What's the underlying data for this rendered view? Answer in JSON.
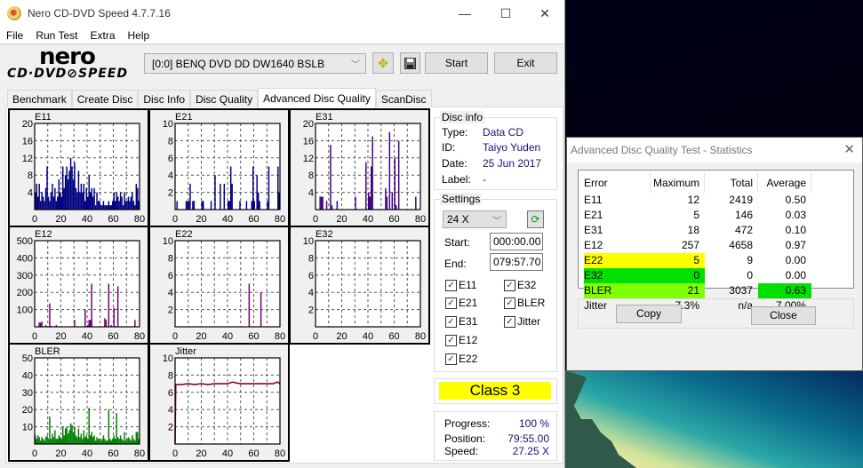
{
  "window": {
    "title": "Nero CD-DVD Speed 4.7.7.16",
    "minimize_glyph": "—",
    "maximize_glyph": "☐",
    "close_glyph": "✕"
  },
  "menu": [
    "File",
    "Run Test",
    "Extra",
    "Help"
  ],
  "logo": {
    "top": "nero",
    "bottom": "CD·DVD⊘SPEED"
  },
  "toolbar": {
    "drive": "[0:0]   BENQ DVD DD DW1640 BSLB",
    "start_label": "Start",
    "exit_label": "Exit",
    "prefs_icon": "✥",
    "save_icon": "💾"
  },
  "tabs": [
    {
      "label": "Benchmark",
      "active": false
    },
    {
      "label": "Create Disc",
      "active": false
    },
    {
      "label": "Disc Info",
      "active": false
    },
    {
      "label": "Disc Quality",
      "active": false
    },
    {
      "label": "Advanced Disc Quality",
      "active": true
    },
    {
      "label": "ScanDisc",
      "active": false
    }
  ],
  "disc_info": {
    "title": "Disc info",
    "rows": [
      {
        "label": "Type:",
        "value": "Data CD"
      },
      {
        "label": "ID:",
        "value": "Taiyo Yuden"
      },
      {
        "label": "Date:",
        "value": "25 Jun 2017"
      },
      {
        "label": "Label:",
        "value": "-"
      }
    ]
  },
  "settings": {
    "title": "Settings",
    "speed": "24 X",
    "start_label": "Start:",
    "start_value": "000:00.00",
    "end_label": "End:",
    "end_value": "079:57.70",
    "checkboxes": [
      {
        "label": "E11",
        "checked": true
      },
      {
        "label": "E32",
        "checked": true
      },
      {
        "label": "E21",
        "checked": true
      },
      {
        "label": "BLER",
        "checked": true
      },
      {
        "label": "E31",
        "checked": true
      },
      {
        "label": "Jitter",
        "checked": true
      },
      {
        "label": "E12",
        "checked": true
      },
      {
        "label": "E22",
        "checked": true
      }
    ]
  },
  "class_badge": {
    "text": "Class 3",
    "color": "#ffff00"
  },
  "progress": {
    "rows": [
      {
        "label": "Progress:",
        "value": "100 %"
      },
      {
        "label": "Position:",
        "value": "79:55.00"
      },
      {
        "label": "Speed:",
        "value": "27.25 X"
      }
    ]
  },
  "stats_dialog": {
    "title": "Advanced Disc Quality Test - Statistics",
    "headers": [
      "Error",
      "Maximum",
      "Total",
      "Average"
    ],
    "rows": [
      {
        "name": "E11",
        "max": "12",
        "total": "2419",
        "avg": "0.50",
        "hl_name": "",
        "hl_avg": ""
      },
      {
        "name": "E21",
        "max": "5",
        "total": "146",
        "avg": "0.03",
        "hl_name": "",
        "hl_avg": ""
      },
      {
        "name": "E31",
        "max": "18",
        "total": "472",
        "avg": "0.10",
        "hl_name": "",
        "hl_avg": ""
      },
      {
        "name": "E12",
        "max": "257",
        "total": "4658",
        "avg": "0.97",
        "hl_name": "",
        "hl_avg": ""
      },
      {
        "name": "E22",
        "max": "5",
        "total": "9",
        "avg": "0.00",
        "hl_name": "#ffff00",
        "hl_avg": ""
      },
      {
        "name": "E32",
        "max": "0",
        "total": "0",
        "avg": "0.00",
        "hl_name": "#00e000",
        "hl_avg": ""
      },
      {
        "name": "BLER",
        "max": "21",
        "total": "3037",
        "avg": "0.63",
        "hl_name": "#80ff00",
        "hl_avg": "#00e000"
      },
      {
        "name": "Jitter",
        "max": "7.3%",
        "total": "n/a",
        "avg": "7.00%",
        "hl_name": "",
        "hl_avg": ""
      }
    ],
    "copy_label": "Copy",
    "close_label": "Close",
    "close_glyph": "✕"
  },
  "chart_data": [
    {
      "type": "bar",
      "title": "E11",
      "color": "#000080",
      "xlim": [
        0,
        80
      ],
      "ylim": [
        0,
        20
      ],
      "xticks": [
        0,
        20,
        40,
        60,
        80
      ],
      "yticks": [
        4,
        8,
        12,
        16,
        20
      ],
      "yticklabels": [
        "4",
        "8",
        "12",
        "16",
        "20"
      ],
      "grid": true,
      "x": [
        0,
        1,
        2,
        3,
        4,
        5,
        6,
        7,
        8,
        9,
        10,
        11,
        12,
        13,
        14,
        15,
        16,
        17,
        18,
        19,
        20,
        21,
        22,
        23,
        24,
        25,
        26,
        27,
        28,
        29,
        30,
        31,
        32,
        33,
        34,
        35,
        36,
        37,
        38,
        39,
        40,
        41,
        42,
        43,
        44,
        45,
        46,
        47,
        48,
        49,
        50,
        51,
        52,
        53,
        54,
        55,
        56,
        57,
        58,
        59,
        60,
        61,
        62,
        63,
        64,
        65,
        66,
        67,
        68,
        69,
        70,
        71,
        72,
        73,
        74,
        75,
        76,
        77,
        78,
        79
      ],
      "values": [
        4,
        6,
        3,
        6,
        2,
        4,
        3,
        2,
        5,
        10,
        3,
        2,
        4,
        6,
        3,
        5,
        2,
        3,
        7,
        4,
        3,
        10,
        5,
        8,
        10,
        7,
        9,
        12,
        10,
        7,
        11,
        5,
        4,
        9,
        4,
        6,
        4,
        6,
        2,
        5,
        3,
        8,
        4,
        5,
        3,
        5,
        1,
        4,
        2,
        2,
        1,
        1,
        2,
        1,
        1,
        1,
        2,
        1,
        1,
        2,
        4,
        2,
        4,
        3,
        2,
        4,
        3,
        1,
        4,
        2,
        2,
        3,
        2,
        3,
        4,
        2,
        1,
        6,
        5,
        2
      ]
    },
    {
      "type": "bar",
      "title": "E21",
      "color": "#000080",
      "xlim": [
        0,
        80
      ],
      "ylim": [
        0,
        10
      ],
      "xticks": [
        0,
        20,
        40,
        60,
        80
      ],
      "yticks": [
        2,
        4,
        6,
        8,
        10
      ],
      "yticklabels": [
        "2",
        "4",
        "6",
        "8",
        "10"
      ],
      "grid": true,
      "x": [
        1,
        8,
        9,
        10,
        11,
        13,
        14,
        20,
        21,
        27,
        30,
        34,
        37,
        40,
        41,
        42,
        43,
        49,
        54,
        58,
        59,
        60,
        62,
        63,
        64,
        70,
        71,
        78,
        79
      ],
      "values": [
        1,
        1,
        1,
        1,
        3,
        1,
        1,
        1,
        1,
        1,
        4,
        3,
        3,
        1,
        1,
        5,
        3,
        1,
        1,
        1,
        5,
        1,
        4,
        2,
        1,
        1,
        5,
        5,
        2
      ]
    },
    {
      "type": "bar",
      "title": "E31",
      "color": "#400080",
      "xlim": [
        0,
        80
      ],
      "ylim": [
        0,
        20
      ],
      "xticks": [
        0,
        20,
        40,
        60,
        80
      ],
      "yticks": [
        4,
        8,
        12,
        16,
        20
      ],
      "yticklabels": [
        "4",
        "8",
        "12",
        "16",
        "20"
      ],
      "grid": true,
      "x": [
        3,
        4,
        5,
        8,
        11,
        12,
        16,
        30,
        38,
        40,
        41,
        42,
        43,
        53,
        54,
        56,
        58,
        60,
        61,
        63,
        76
      ],
      "values": [
        3,
        3,
        3,
        2,
        15,
        1,
        2,
        3,
        11,
        4,
        3,
        10,
        17,
        5,
        3,
        18,
        4,
        12,
        1,
        16,
        3
      ]
    },
    {
      "type": "bar",
      "title": "E12",
      "color": "#700070",
      "xlim": [
        0,
        80
      ],
      "ylim": [
        0,
        500
      ],
      "xticks": [
        0,
        20,
        40,
        60,
        80
      ],
      "yticks": [
        100,
        200,
        300,
        400,
        500
      ],
      "yticklabels": [
        "100",
        "200",
        "300",
        "400",
        "500"
      ],
      "grid": true,
      "x": [
        3,
        4,
        5,
        8,
        11,
        12,
        16,
        30,
        38,
        40,
        41,
        42,
        43,
        53,
        54,
        56,
        58,
        60,
        61,
        63,
        76
      ],
      "values": [
        25,
        25,
        30,
        10,
        135,
        5,
        10,
        40,
        100,
        10,
        40,
        40,
        250,
        50,
        40,
        250,
        10,
        110,
        5,
        235,
        40
      ]
    },
    {
      "type": "bar",
      "title": "E22",
      "color": "#700070",
      "xlim": [
        0,
        80
      ],
      "ylim": [
        0,
        10
      ],
      "xticks": [
        0,
        20,
        40,
        60,
        80
      ],
      "yticks": [
        2,
        4,
        6,
        8,
        10
      ],
      "yticklabels": [
        "2",
        "4",
        "6",
        "8",
        "10"
      ],
      "grid": true,
      "x": [
        56,
        65
      ],
      "values": [
        5,
        4
      ]
    },
    {
      "type": "bar",
      "title": "E32",
      "color": "#700070",
      "xlim": [
        0,
        80
      ],
      "ylim": [
        0,
        10
      ],
      "xticks": [
        0,
        20,
        40,
        60,
        80
      ],
      "yticks": [
        2,
        4,
        6,
        8,
        10
      ],
      "yticklabels": [
        "2",
        "4",
        "6",
        "8",
        "10"
      ],
      "grid": true,
      "x": [],
      "values": []
    },
    {
      "type": "bar",
      "title": "BLER",
      "color": "#008000",
      "xlim": [
        0,
        80
      ],
      "ylim": [
        0,
        50
      ],
      "xticks": [
        0,
        20,
        40,
        60,
        80
      ],
      "yticks": [
        10,
        20,
        30,
        40,
        50
      ],
      "yticklabels": [
        "10",
        "20",
        "30",
        "40",
        "50"
      ],
      "grid": true,
      "x": [
        0,
        1,
        2,
        3,
        4,
        5,
        6,
        7,
        8,
        9,
        10,
        11,
        12,
        13,
        14,
        15,
        16,
        17,
        18,
        19,
        20,
        21,
        22,
        23,
        24,
        25,
        26,
        27,
        28,
        29,
        30,
        31,
        32,
        33,
        34,
        35,
        36,
        37,
        38,
        39,
        40,
        41,
        42,
        43,
        44,
        45,
        46,
        47,
        48,
        49,
        50,
        51,
        52,
        53,
        54,
        55,
        56,
        57,
        58,
        59,
        60,
        61,
        62,
        63,
        64,
        65,
        66,
        67,
        68,
        69,
        70,
        71,
        72,
        73,
        74,
        75,
        76,
        77,
        78,
        79
      ],
      "values": [
        5,
        3,
        5,
        4,
        2,
        4,
        3,
        2,
        4,
        5,
        3,
        16,
        3,
        6,
        4,
        8,
        3,
        3,
        5,
        4,
        3,
        10,
        5,
        9,
        10,
        6,
        8,
        12,
        11,
        7,
        10,
        5,
        4,
        9,
        4,
        6,
        3,
        8,
        4,
        5,
        3,
        21,
        5,
        7,
        4,
        5,
        2,
        4,
        3,
        3,
        2,
        3,
        5,
        3,
        2,
        2,
        20,
        3,
        2,
        3,
        5,
        3,
        18,
        4,
        3,
        5,
        3,
        2,
        7,
        2,
        3,
        4,
        3,
        2,
        5,
        3,
        2,
        7,
        7,
        3
      ]
    },
    {
      "type": "line",
      "title": "Jitter",
      "color": "#800040",
      "xlim": [
        0,
        80
      ],
      "ylim": [
        0,
        10
      ],
      "xticks": [
        0,
        20,
        40,
        60,
        80
      ],
      "yticks": [
        2,
        4,
        6,
        8,
        10
      ],
      "yticklabels": [
        "2",
        "4",
        "6",
        "8",
        "10"
      ],
      "grid": true,
      "x": [
        0,
        0.5,
        5,
        10,
        15,
        20,
        25,
        30,
        35,
        40,
        42,
        44,
        46,
        50,
        55,
        60,
        65,
        70,
        75,
        78,
        80
      ],
      "values": [
        0,
        6.9,
        6.9,
        7.0,
        6.9,
        7.0,
        6.9,
        7.0,
        7.0,
        7.0,
        7.1,
        7.2,
        7.1,
        7.0,
        7.0,
        7.0,
        7.0,
        7.0,
        7.0,
        7.2,
        7.0
      ]
    }
  ]
}
